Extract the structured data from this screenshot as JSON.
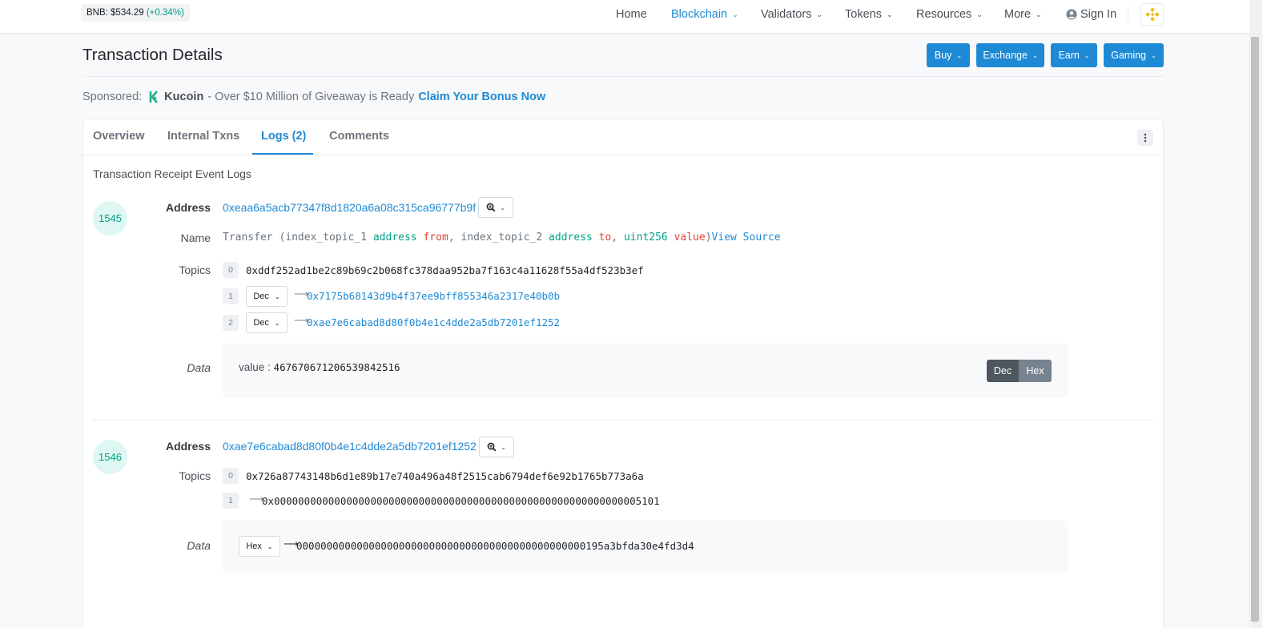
{
  "header": {
    "price_label": "BNB: $534.29",
    "price_change": "(+0.34%)",
    "nav": [
      {
        "label": "Home"
      },
      {
        "label": "Blockchain"
      },
      {
        "label": "Validators"
      },
      {
        "label": "Tokens"
      },
      {
        "label": "Resources"
      },
      {
        "label": "More"
      },
      {
        "label": "Sign In"
      }
    ]
  },
  "page": {
    "title": "Transaction Details",
    "action_buttons": [
      {
        "label": "Buy"
      },
      {
        "label": "Exchange"
      },
      {
        "label": "Earn"
      },
      {
        "label": "Gaming"
      }
    ]
  },
  "sponsored": {
    "prefix": "Sponsored:",
    "brand": "Kucoin",
    "text": "- Over $10 Million of Giveaway is Ready",
    "cta": "Claim Your Bonus Now"
  },
  "tabs": [
    {
      "label": "Overview"
    },
    {
      "label": "Internal Txns"
    },
    {
      "label": "Logs (2)"
    },
    {
      "label": "Comments"
    }
  ],
  "card_heading": "Transaction Receipt Event Logs",
  "labels": {
    "address": "Address",
    "name": "Name",
    "topics": "Topics",
    "data": "Data"
  },
  "logs": [
    {
      "index": "1545",
      "address": "0xeaa6a5acb77347f8d1820a6a08c315ca96777b9f",
      "name": {
        "prefix": "Transfer (index_topic_1 ",
        "t1": "address",
        "p1": "from",
        "mid": ", index_topic_2 ",
        "t2": "address",
        "p2": "to",
        "sep": ", ",
        "t3": "uint256",
        "p3": "value",
        "suffix": ")",
        "view_source": "View Source"
      },
      "topics": [
        {
          "i": "0",
          "value": "0xddf252ad1be2c89b69c2b068fc378daa952ba7f163c4a11628f55a4df523b3ef"
        },
        {
          "i": "1",
          "format": "Dec",
          "value": "0x7175b68143d9b4f37ee9bff855346a2317e40b0b"
        },
        {
          "i": "2",
          "format": "Dec",
          "value": "0xae7e6cabad8d80f0b4e1c4dde2a5db7201ef1252"
        }
      ],
      "data": {
        "label": "value :",
        "value": "467670671206539842516",
        "toggle_dec": "Dec",
        "toggle_hex": "Hex"
      }
    },
    {
      "index": "1546",
      "address": "0xae7e6cabad8d80f0b4e1c4dde2a5db7201ef1252",
      "topics": [
        {
          "i": "0",
          "value": "0x726a87743148b6d1e89b17e740a496a48f2515cab6794def6e92b1765b773a6a"
        },
        {
          "i": "1",
          "value": "0x0000000000000000000000000000000000000000000000000000000000005101"
        }
      ],
      "data": {
        "format": "Hex",
        "value": "000000000000000000000000000000000000000000000000195a3bfda30e4fd3d4"
      }
    }
  ],
  "colors": {
    "accent": "#1e8ad6",
    "success": "#00a186",
    "danger": "#de4437",
    "bnb": "#f0b90b"
  }
}
